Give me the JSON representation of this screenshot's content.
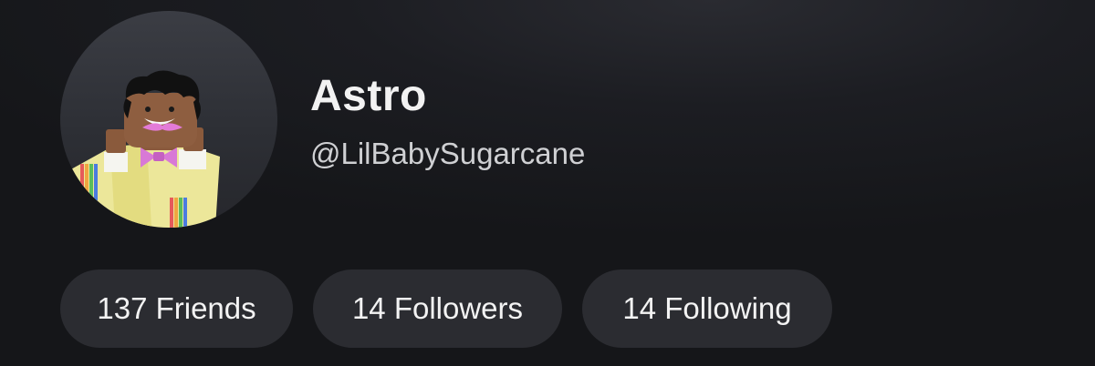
{
  "profile": {
    "display_name": "Astro",
    "username": "@LilBabySugarcane"
  },
  "stats": {
    "friends_label": "137 Friends",
    "followers_label": "14 Followers",
    "following_label": "14 Following"
  },
  "colors": {
    "background": "#151619",
    "pill_background": "#2b2c31",
    "avatar_background": "#33353b",
    "text_primary": "#f2f2f2",
    "text_secondary": "#cfd0d3"
  },
  "icons": {
    "avatar": "user-avatar-icon"
  }
}
